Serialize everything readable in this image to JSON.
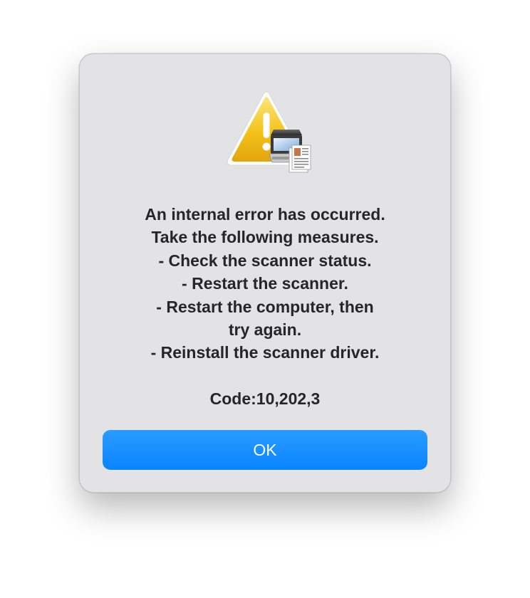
{
  "dialog": {
    "icon": "caution-scanner-icon",
    "message_lines": [
      "An internal error has occurred.",
      "Take the following measures.",
      "- Check the scanner status.",
      "- Restart the scanner.",
      "- Restart the computer, then",
      "try again.",
      "- Reinstall the scanner driver."
    ],
    "code": "Code:10,202,3",
    "ok_label": "OK"
  },
  "colors": {
    "dialog_background": "#e3e3e5",
    "text": "#262626",
    "button_accent": "#0a84ff",
    "warning_yellow": "#f2c318"
  }
}
